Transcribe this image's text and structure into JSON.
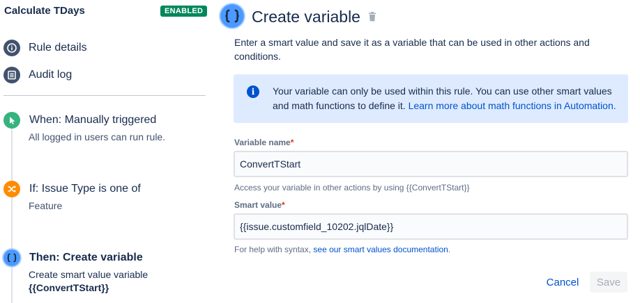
{
  "rule": {
    "title": "Calculate TDays",
    "status_badge": "ENABLED"
  },
  "nav": {
    "rule_details": "Rule details",
    "audit_log": "Audit log"
  },
  "steps": [
    {
      "title": "When: Manually triggered",
      "subtitle": "All logged in users can run rule."
    },
    {
      "title": "If: Issue Type is one of",
      "subtitle": "Feature"
    },
    {
      "title": "Then: Create variable",
      "subtitle": "Create smart value variable",
      "detail": "{{ConvertTStart}}"
    }
  ],
  "panel": {
    "title": "Create variable",
    "intro": "Enter a smart value and save it as a variable that can be used in other actions and conditions.",
    "info_text": "Your variable can only be used within this rule. You can use other smart values and math functions to define it. ",
    "info_link": "Learn more about math functions in Automation."
  },
  "form": {
    "variable_name_label": "Variable name",
    "variable_name_value": "ConvertTStart",
    "variable_name_help": "Access your variable in other actions by using {{ConvertTStart}}",
    "smart_value_label": "Smart value",
    "smart_value_value": "{{issue.customfield_10202.jqlDate}}",
    "smart_value_help": "For help with syntax, ",
    "smart_value_help_link": "see our smart values documentation",
    "required_mark": "*"
  },
  "actions": {
    "cancel": "Cancel",
    "save": "Save"
  },
  "colors": {
    "enabled_badge": "#00875a",
    "trigger_icon": "#36b37e",
    "condition_icon": "#ff8b00",
    "action_icon": "#4c9aff",
    "link": "#0052cc",
    "info_bg": "#deebff"
  }
}
